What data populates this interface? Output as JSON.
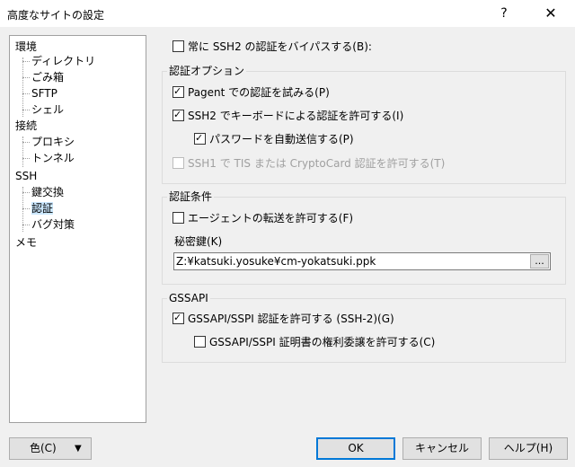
{
  "window": {
    "title": "高度なサイトの設定",
    "help": "?",
    "close": "✕"
  },
  "tree": [
    {
      "label": "環境"
    },
    {
      "label": "ディレクトリ"
    },
    {
      "label": "ごみ箱"
    },
    {
      "label": "SFTP"
    },
    {
      "label": "シェル"
    },
    {
      "label": "接続"
    },
    {
      "label": "プロキシ"
    },
    {
      "label": "トンネル"
    },
    {
      "label": "SSH"
    },
    {
      "label": "鍵交換"
    },
    {
      "label": "認証",
      "selected": true
    },
    {
      "label": "バグ対策"
    },
    {
      "label": "メモ"
    }
  ],
  "bypass": {
    "label": "常に SSH2 の認証をバイパスする(B):",
    "checked": false
  },
  "auth_options": {
    "title": "認証オプション",
    "pageant": {
      "label": "Pagent での認証を試みる(P)",
      "checked": true
    },
    "keyboard": {
      "label": "SSH2 でキーボードによる認証を許可する(I)",
      "checked": true
    },
    "password": {
      "label": "パスワードを自動送信する(P)",
      "checked": true
    },
    "tis": {
      "label": "SSH1 で TIS または CryptoCard 認証を許可する(T)",
      "checked": false,
      "disabled": true
    }
  },
  "auth_params": {
    "title": "認証条件",
    "agent_fwd": {
      "label": "エージェントの転送を許可する(F)",
      "checked": false
    },
    "private_key_label": "秘密鍵(K)",
    "private_key_value": "Z:¥katsuki.yosuke¥cm-yokatsuki.ppk",
    "browse": "..."
  },
  "gssapi": {
    "title": "GSSAPI",
    "allow": {
      "label": "GSSAPI/SSPI 認証を許可する (SSH-2)(G)",
      "checked": true
    },
    "delegate": {
      "label": "GSSAPI/SSPI 証明書の権利委譲を許可する(C)",
      "checked": false
    }
  },
  "buttons": {
    "color": "色(C)",
    "color_arrow": "▼",
    "ok": "OK",
    "cancel": "キャンセル",
    "help": "ヘルプ(H)"
  }
}
